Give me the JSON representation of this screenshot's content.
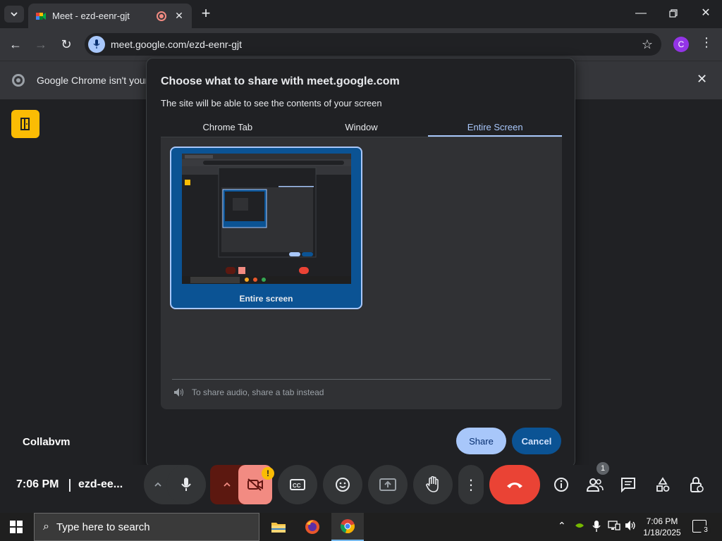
{
  "browser": {
    "tab_title": "Meet - ezd-eenr-gjt",
    "url": "meet.google.com/ezd-eenr-gjt",
    "profile_initial": "C",
    "infobar_message": "Google Chrome isn't your d"
  },
  "meet": {
    "participant_name": "Collabvm",
    "time": "7:06 PM",
    "meeting_code": "ezd-ee...",
    "participants_count": "1",
    "warning_badge": "!"
  },
  "dialog": {
    "title": "Choose what to share with meet.google.com",
    "subtitle": "The site will be able to see the contents of your screen",
    "tabs": [
      "Chrome Tab",
      "Window",
      "Entire Screen"
    ],
    "active_tab": "Entire Screen",
    "source_label": "Entire screen",
    "audio_note": "To share audio, share a tab instead",
    "share_label": "Share",
    "cancel_label": "Cancel"
  },
  "taskbar": {
    "search_placeholder": "Type here to search",
    "time": "7:06 PM",
    "date": "1/18/2025",
    "notifications": "3"
  },
  "colors": {
    "accent": "#a8c7fa",
    "selected_card": "#0b5394",
    "end_call": "#ea4335",
    "camera_off": "#f28b82",
    "meet_logo": "#fbbc04"
  }
}
